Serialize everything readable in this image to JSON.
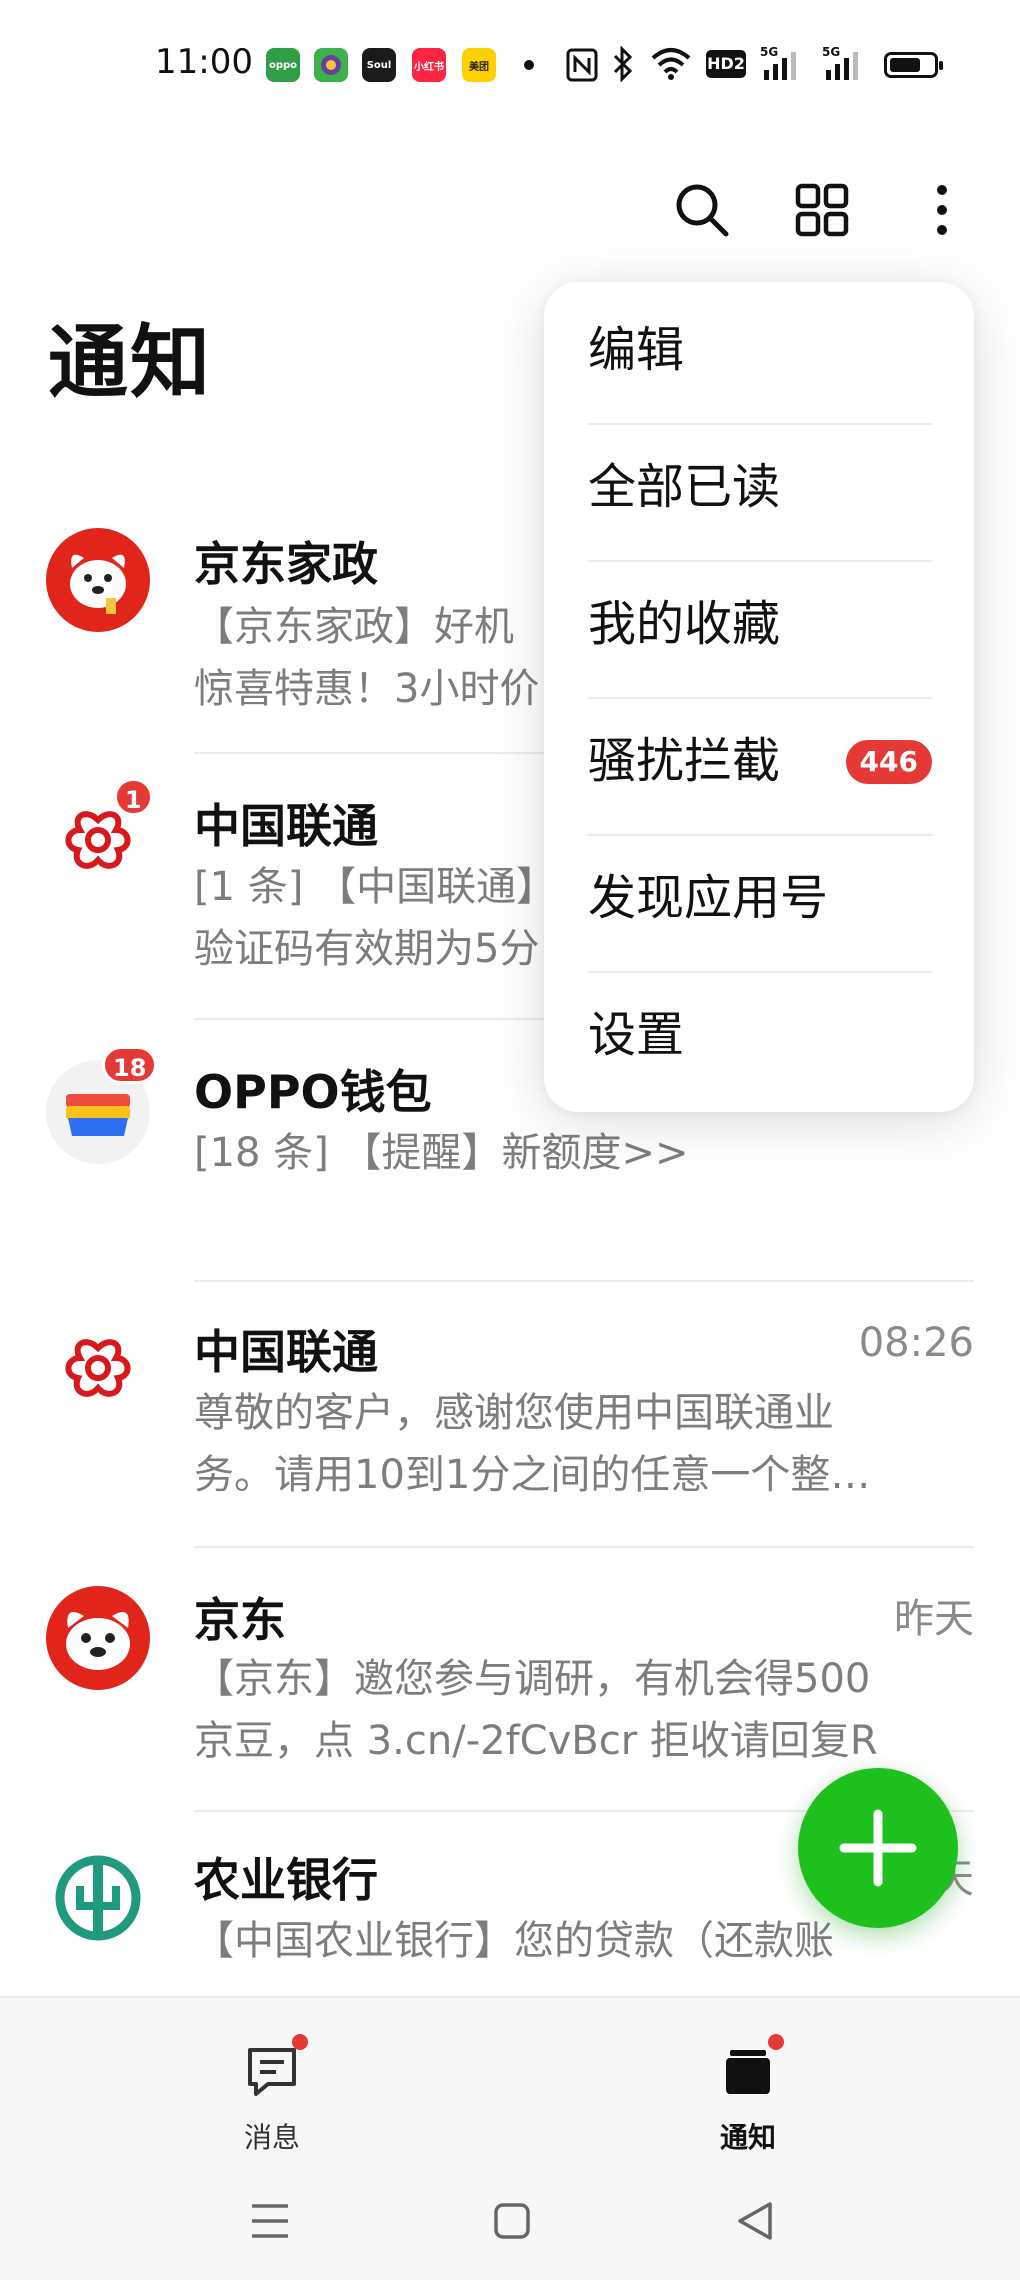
{
  "status_bar": {
    "time": "11:00",
    "apps": [
      "oppo",
      "game",
      "Soul",
      "小红书",
      "美团"
    ],
    "network": "5G",
    "hd": "HD2"
  },
  "toolbar": {
    "icons": [
      "search-icon",
      "grid-icon",
      "more-icon"
    ]
  },
  "page": {
    "title": "通知"
  },
  "notifications": [
    {
      "title": "京东家政",
      "time": "",
      "preview_line1": "【京东家政】好机",
      "preview_line2": "惊喜特惠！3小时价",
      "badge": ""
    },
    {
      "title": "中国联通",
      "time": "",
      "preview_line1": "[1 条] 【中国联通】",
      "preview_line2": "验证码有效期为5分",
      "badge": "1"
    },
    {
      "title": "OPPO钱包",
      "time": "",
      "preview_line1": "[18 条] 【提醒】新额度>>",
      "preview_line2": "",
      "badge": "18"
    },
    {
      "title": "中国联通",
      "time": "08:26",
      "preview_line1": "尊敬的客户，感谢您使用中国联通业",
      "preview_line2": "务。请用10到1分之间的任意一个整…",
      "badge": ""
    },
    {
      "title": "京东",
      "time": "昨天",
      "preview_line1": "【京东】邀您参与调研，有机会得500",
      "preview_line2": "京豆，点 3.cn/-2fCvBcr 拒收请回复R",
      "badge": ""
    },
    {
      "title": "农业银行",
      "time": "昨天",
      "preview_line1": "【中国农业银行】您的贷款（还款账",
      "preview_line2": "",
      "badge": ""
    }
  ],
  "menu": {
    "items": [
      {
        "label": "编辑",
        "badge": ""
      },
      {
        "label": "全部已读",
        "badge": ""
      },
      {
        "label": "我的收藏",
        "badge": ""
      },
      {
        "label": "骚扰拦截",
        "badge": "446"
      },
      {
        "label": "发现应用号",
        "badge": ""
      },
      {
        "label": "设置",
        "badge": ""
      }
    ]
  },
  "bottom_nav": {
    "tabs": [
      {
        "label": "消息"
      },
      {
        "label": "通知"
      }
    ]
  },
  "colors": {
    "accent_green": "#1ec01e",
    "badge_red": "#e53935",
    "jd_red": "#e1251b",
    "unicom_red": "#d7191d",
    "abc_green": "#1f9a7e"
  }
}
